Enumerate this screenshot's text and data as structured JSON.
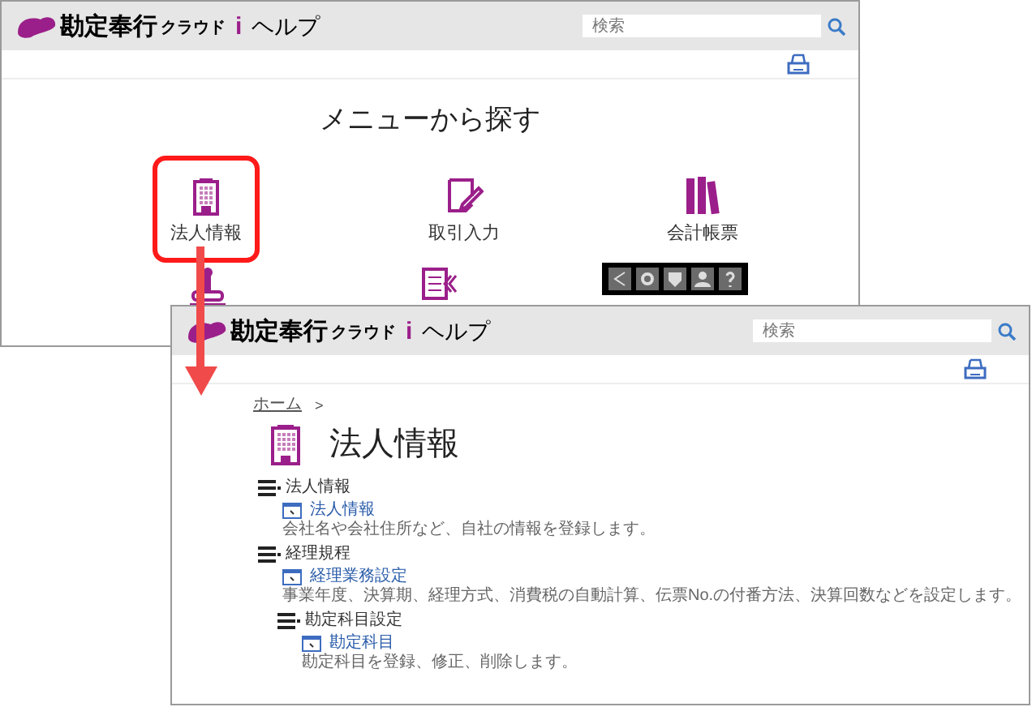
{
  "back_window": {
    "brand": {
      "name": "勘定奉行",
      "suffix": "クラウド",
      "mark": "i",
      "help": "ヘルプ"
    },
    "search": {
      "placeholder": "検索"
    },
    "heading": "メニューから探す",
    "menu": [
      {
        "label": "法人情報",
        "kind": "building",
        "selected": true
      },
      {
        "label": "取引入力",
        "kind": "note",
        "selected": false
      },
      {
        "label": "会計帳票",
        "kind": "books",
        "selected": false
      }
    ]
  },
  "front_window": {
    "brand": {
      "name": "勘定奉行",
      "suffix": "クラウド",
      "mark": "i",
      "help": "ヘルプ"
    },
    "search": {
      "placeholder": "検索"
    },
    "breadcrumb": {
      "home": "ホーム",
      "separator": ">"
    },
    "title": "法人情報",
    "sections": [
      {
        "heading": "法人情報",
        "link": "法人情報",
        "description": "会社名や会社住所など、自社の情報を登録します。"
      },
      {
        "heading": "経理規程",
        "link": "経理業務設定",
        "description": "事業年度、決算期、経理方式、消費税の自動計算、伝票No.の付番方法、決算回数などを設定します。",
        "children": [
          {
            "heading": "勘定科目設定",
            "link": "勘定科目",
            "description": "勘定科目を登録、修正、削除します。"
          }
        ]
      }
    ]
  }
}
